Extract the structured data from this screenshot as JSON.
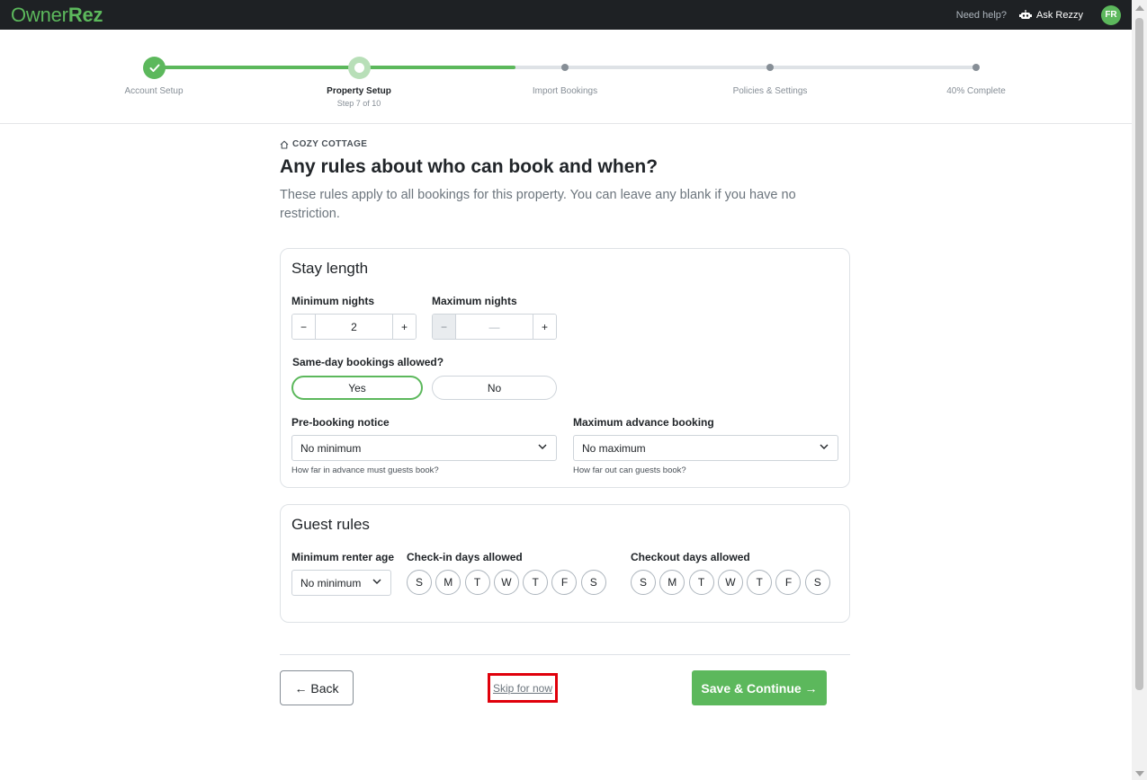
{
  "app": {
    "logo_owner": "Owner",
    "logo_rez": "Rez",
    "need_help": "Need help?",
    "ask_rezzy": "Ask Rezzy",
    "avatar_initials": "FR"
  },
  "progress": {
    "fraction_complete": 0.44,
    "steps": [
      {
        "label": "Account Setup",
        "state": "done"
      },
      {
        "label": "Property Setup",
        "state": "current",
        "sub": "Step 7 of 10"
      },
      {
        "label": "Import Bookings",
        "state": "pending"
      },
      {
        "label": "Policies & Settings",
        "state": "pending"
      },
      {
        "label": "40% Complete",
        "state": "pending"
      }
    ]
  },
  "page": {
    "property_name": "COZY COTTAGE",
    "title": "Any rules about who can book and when?",
    "description": "These rules apply to all bookings for this property. You can leave any blank if you have no restriction."
  },
  "stay_length": {
    "title": "Stay length",
    "min_nights_label": "Minimum nights",
    "min_nights_value": "2",
    "max_nights_label": "Maximum nights",
    "max_nights_value": "—",
    "minus": "−",
    "plus": "+",
    "same_day_label": "Same-day bookings allowed?",
    "yes": "Yes",
    "no": "No",
    "prebooking_label": "Pre-booking notice",
    "prebooking_value": "No minimum",
    "prebooking_help": "How far in advance must guests book?",
    "max_advance_label": "Maximum advance booking",
    "max_advance_value": "No maximum",
    "max_advance_help": "How far out can guests book?"
  },
  "guest_rules": {
    "title": "Guest rules",
    "min_age_label": "Minimum renter age",
    "min_age_value": "No minimum",
    "checkin_label": "Check-in days allowed",
    "checkout_label": "Checkout days allowed",
    "days": [
      "S",
      "M",
      "T",
      "W",
      "T",
      "F",
      "S"
    ]
  },
  "footer": {
    "back": "← Back",
    "skip": "Skip for now",
    "save": "Save & Continue →"
  },
  "colors": {
    "brand_green": "#5cb85c",
    "topbar": "#1e2124",
    "highlight_red": "#e0000b"
  }
}
